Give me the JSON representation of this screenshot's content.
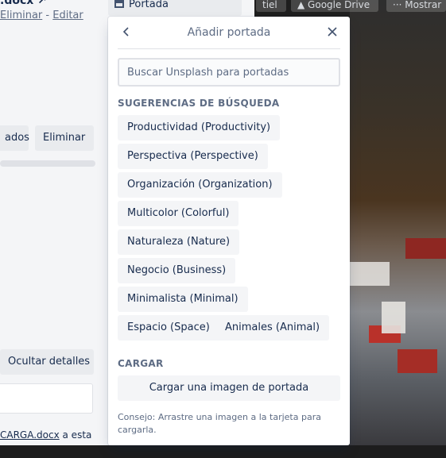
{
  "topbar": {
    "buttons": [
      {
        "label": "tiel"
      },
      {
        "label": "Google Drive"
      },
      {
        "label": "Mostrar"
      }
    ]
  },
  "card": {
    "title": ".docx",
    "edit_links": {
      "delete": "Eliminar",
      "separator": "-",
      "edit": "Editar"
    },
    "buttons": {
      "partial_left": "ados",
      "delete": "Eliminar",
      "hide_details": "Ocultar detalles"
    },
    "bottom": {
      "link": "CARGA.docx",
      "text": " a esta"
    },
    "sidebar_item": {
      "label": "Portada"
    }
  },
  "popover": {
    "title": "Añadir portada",
    "search": {
      "placeholder": "Buscar Unsplash para portadas",
      "value": ""
    },
    "suggestions_label": "SUGERENCIAS DE BÚSQUEDA",
    "suggestions": [
      "Productividad (Productivity)",
      "Perspectiva (Perspective)",
      "Organización (Organization)",
      "Multicolor (Colorful)",
      "Naturaleza (Nature)",
      "Negocio (Business)",
      "Minimalista (Minimal)",
      "Espacio (Space)",
      "Animales (Animal)"
    ],
    "upload_label": "CARGAR",
    "upload_button": "Cargar una imagen de portada",
    "tip": "Consejo: Arrastre una imagen a la tarjeta para cargarla."
  }
}
